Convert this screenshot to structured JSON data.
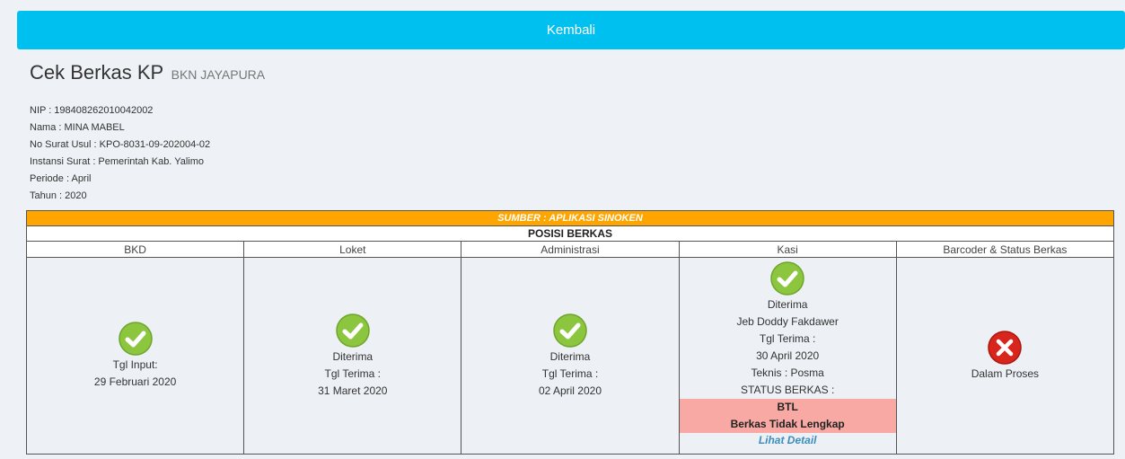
{
  "back_button": {
    "label": "Kembali"
  },
  "header": {
    "title": "Cek Berkas KP",
    "subtitle": "BKN JAYAPURA"
  },
  "info": [
    "NIP : 198408262010042002",
    "Nama : MINA MABEL",
    "No Surat Usul : KPO-8031-09-202004-02",
    "Instansi Surat : Pemerintah Kab. Yalimo",
    "Periode : April",
    "Tahun : 2020"
  ],
  "table": {
    "source": "SUMBER : APLIKASI SINOKEN",
    "position_title": "POSISI BERKAS",
    "columns": [
      "BKD",
      "Loket",
      "Administrasi",
      "Kasi",
      "Barcoder & Status Berkas"
    ],
    "bkd": {
      "line1": "Tgl Input:",
      "line2": "29 Februari 2020"
    },
    "loket": {
      "status": "Diterima",
      "label": "Tgl Terima :",
      "date": "31 Maret 2020"
    },
    "administrasi": {
      "status": "Diterima",
      "label": "Tgl Terima :",
      "date": "02 April 2020"
    },
    "kasi": {
      "status": "Diterima",
      "name": "Jeb Doddy Fakdawer",
      "label": "Tgl Terima :",
      "date": "30 April 2020",
      "teknis": "Teknis : Posma",
      "status_label": "STATUS BERKAS :",
      "btl_code": "BTL",
      "btl_desc": "Berkas Tidak Lengkap",
      "detail_link": "Lihat Detail"
    },
    "barcoder": {
      "status": "Dalam Proses"
    }
  },
  "colors": {
    "accent": "#00c0ef",
    "source_bar": "#ffa500",
    "ok": "#8cc63f",
    "error": "#d9261c",
    "btl": "#f8a9a3"
  }
}
